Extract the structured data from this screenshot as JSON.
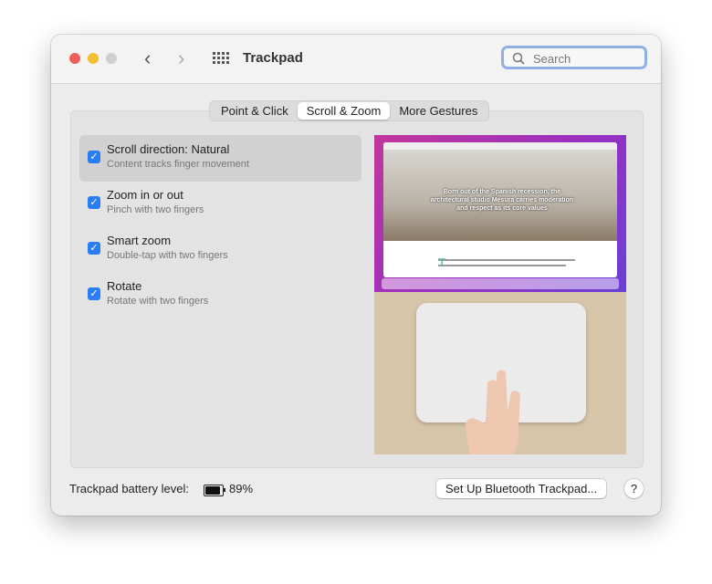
{
  "window": {
    "title": "Trackpad"
  },
  "search": {
    "placeholder": "Search"
  },
  "tabs": [
    {
      "label": "Point & Click"
    },
    {
      "label": "Scroll & Zoom",
      "active": true
    },
    {
      "label": "More Gestures"
    }
  ],
  "options": [
    {
      "label": "Scroll direction: Natural",
      "description": "Content tracks finger movement",
      "checked": true,
      "selected": true
    },
    {
      "label": "Zoom in or out",
      "description": "Pinch with two fingers",
      "checked": true
    },
    {
      "label": "Smart zoom",
      "description": "Double-tap with two fingers",
      "checked": true
    },
    {
      "label": "Rotate",
      "description": "Rotate with two fingers",
      "checked": true
    }
  ],
  "preview": {
    "headline": "Born out of the Spanish recession, the architectural studio Mesura carries moderation and respect as its core values"
  },
  "footer": {
    "battery_label": "Trackpad battery level:",
    "battery_percent": "89%",
    "battery_level": 0.89,
    "setup_button": "Set Up Bluetooth Trackpad...",
    "help_button": "?"
  },
  "colors": {
    "accent": "#2a7ef4",
    "close": "#ed5f57",
    "minimize": "#f5bd30",
    "focus_ring": "#8fb0e3"
  }
}
